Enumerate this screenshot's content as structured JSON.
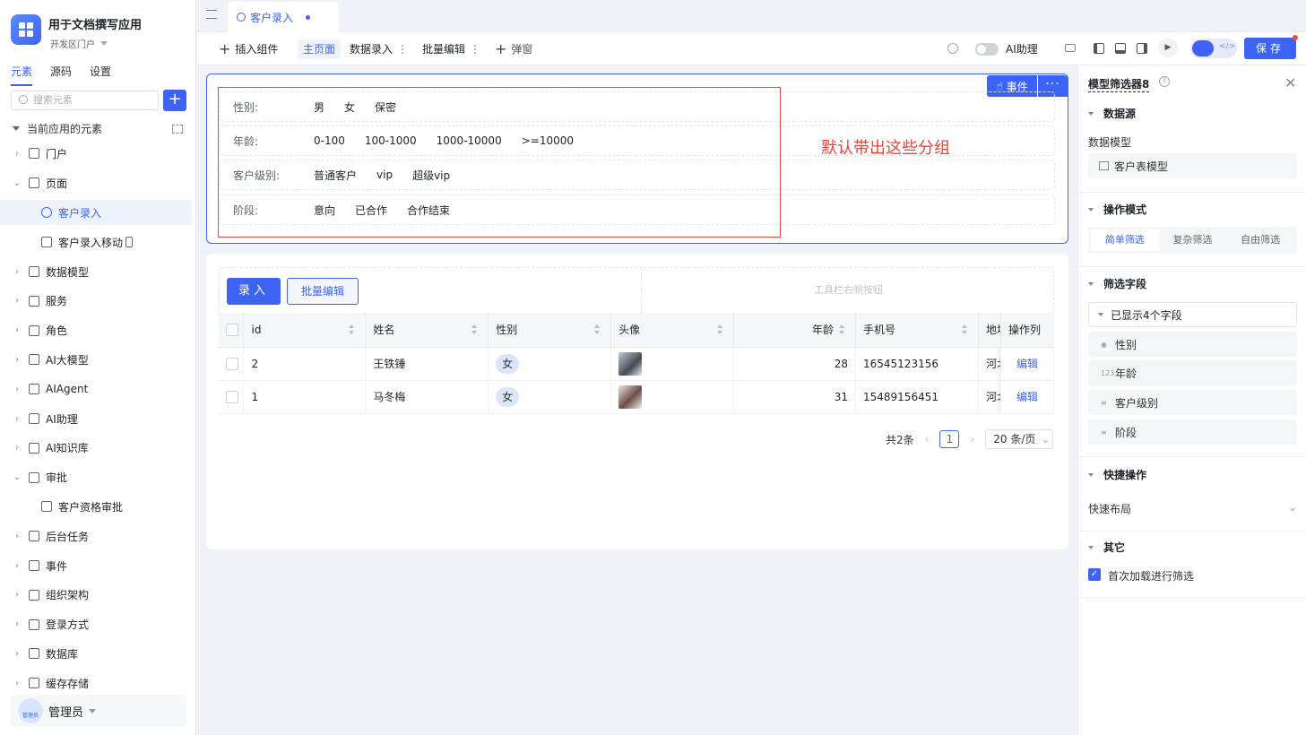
{
  "app": {
    "name": "用于文档撰写应用",
    "env": "开发区门户"
  },
  "sidebar": {
    "tabs": [
      "元素",
      "源码",
      "设置"
    ],
    "search_placeholder": "搜索元素",
    "add_label": "+",
    "section_title": "当前应用的元素",
    "items": [
      {
        "label": "门户",
        "icon": "home-icon",
        "expanded": false,
        "level": 0
      },
      {
        "label": "页面",
        "icon": "page-icon",
        "expanded": true,
        "level": 0
      },
      {
        "label": "客户录入",
        "icon": "page-link-icon",
        "level": 1,
        "active": true
      },
      {
        "label": "客户录入移动",
        "icon": "page-link-icon",
        "level": 1,
        "mobile": true
      },
      {
        "label": "数据模型",
        "icon": "table-icon",
        "expanded": false,
        "level": 0
      },
      {
        "label": "服务",
        "icon": "service-icon",
        "expanded": false,
        "level": 0
      },
      {
        "label": "角色",
        "icon": "role-icon",
        "expanded": false,
        "level": 0
      },
      {
        "label": "AI大模型",
        "icon": "ai-model-icon",
        "expanded": false,
        "level": 0
      },
      {
        "label": "AIAgent",
        "icon": "robot-icon",
        "expanded": false,
        "level": 0
      },
      {
        "label": "AI助理",
        "icon": "ai-assistant-icon",
        "expanded": false,
        "level": 0
      },
      {
        "label": "AI知识库",
        "icon": "book-icon",
        "expanded": false,
        "level": 0
      },
      {
        "label": "审批",
        "icon": "approval-icon",
        "expanded": true,
        "level": 0
      },
      {
        "label": "客户资格审批",
        "icon": "approval-icon",
        "level": 1
      },
      {
        "label": "后台任务",
        "icon": "task-icon",
        "expanded": false,
        "level": 0
      },
      {
        "label": "事件",
        "icon": "event-icon",
        "expanded": false,
        "level": 0
      },
      {
        "label": "组织架构",
        "icon": "org-icon",
        "expanded": false,
        "level": 0
      },
      {
        "label": "登录方式",
        "icon": "login-icon",
        "expanded": false,
        "level": 0
      },
      {
        "label": "数据库",
        "icon": "database-icon",
        "expanded": false,
        "level": 0
      },
      {
        "label": "缓存存储",
        "icon": "cache-icon",
        "expanded": false,
        "level": 0
      }
    ],
    "user": {
      "name": "管理员",
      "avatar_text": "管理员"
    }
  },
  "tabbar": {
    "active_tab": "客户录入"
  },
  "toolbar": {
    "insert": "插入组件",
    "main_page": "主页面",
    "data_entry": "数据录入",
    "batch_edit": "批量编辑",
    "popup": "弹窗",
    "ai_label": "AI助理",
    "save": "保存"
  },
  "filter": {
    "event_btn": "事件",
    "more_btn": "···",
    "rows": [
      {
        "label": "性别:",
        "options": [
          "男",
          "女",
          "保密"
        ]
      },
      {
        "label": "年龄:",
        "options": [
          "0-100",
          "100-1000",
          "1000-10000",
          ">=10000"
        ]
      },
      {
        "label": "客户级别:",
        "options": [
          "普通客户",
          "vip",
          "超级vip"
        ]
      },
      {
        "label": "阶段:",
        "options": [
          "意向",
          "已合作",
          "合作结束"
        ]
      }
    ],
    "annotation": "默认带出这些分组"
  },
  "table": {
    "entry_btn": "录入",
    "batch_btn": "批量编辑",
    "toolbar_right": "工具栏右侧按钮",
    "columns": [
      "id",
      "姓名",
      "性别",
      "头像",
      "年龄",
      "手机号",
      "地址",
      "操作列"
    ],
    "rows": [
      {
        "id": "2",
        "name": "王铁锤",
        "gender": "女",
        "age": "28",
        "phone": "16545123156",
        "addr": "河北",
        "action": "编辑"
      },
      {
        "id": "1",
        "name": "马冬梅",
        "gender": "女",
        "age": "31",
        "phone": "15489156451",
        "addr": "河北",
        "action": "编辑"
      }
    ],
    "pager": {
      "total": "共2条",
      "page": "1",
      "size": "20 条/页"
    }
  },
  "rpanel": {
    "title": "模型筛选器8",
    "sections": {
      "datasource": "数据源",
      "op_mode": "操作模式",
      "fields": "筛选字段",
      "quick": "快捷操作",
      "other": "其它"
    },
    "data_model_label": "数据模型",
    "data_model_value": "客户表模型",
    "modes": [
      "简单筛选",
      "复杂筛选",
      "自由筛选"
    ],
    "fields_header": "已显示4个字段",
    "field_items": [
      {
        "label": "性别",
        "type": "◉"
      },
      {
        "label": "年龄",
        "type": "123"
      },
      {
        "label": "客户级别",
        "type": "≡"
      },
      {
        "label": "阶段",
        "type": "≡"
      }
    ],
    "quick_layout": "快速布局",
    "first_load": "首次加载进行筛选"
  }
}
